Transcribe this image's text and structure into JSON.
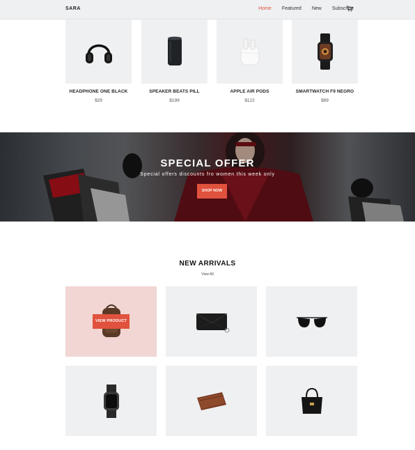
{
  "nav": {
    "brand": "SARA",
    "links": [
      "Home",
      "Featured",
      "New",
      "Subscribe"
    ],
    "active_link": "Home",
    "cart_icon": "cart-icon",
    "accent": "#e0523d"
  },
  "products": [
    {
      "name": "HEADPHONE ONE BLACK",
      "price": "$29",
      "icon": "headphone-icon"
    },
    {
      "name": "SPEAKER BEATS PILL",
      "price": "$199",
      "icon": "speaker-icon"
    },
    {
      "name": "APPLE AIR PODS",
      "price": "$122",
      "icon": "airpods-icon"
    },
    {
      "name": "SMARTWATCH F9 NEGRO",
      "price": "$99",
      "icon": "smartwatch-icon"
    }
  ],
  "banner": {
    "title": "SPECIAL OFFER",
    "subtitle": "Special offers discounts fro women this week only",
    "button": "SHOP NOW"
  },
  "new_arrivals": {
    "title": "NEW ARRIVALS",
    "link": "View All",
    "hover_button": "VIEW PRODUCT",
    "items": [
      "backpack-icon",
      "clutch-bag-icon",
      "sunglasses-icon",
      "watch-icon",
      "wallet-icon",
      "handbag-icon"
    ]
  }
}
